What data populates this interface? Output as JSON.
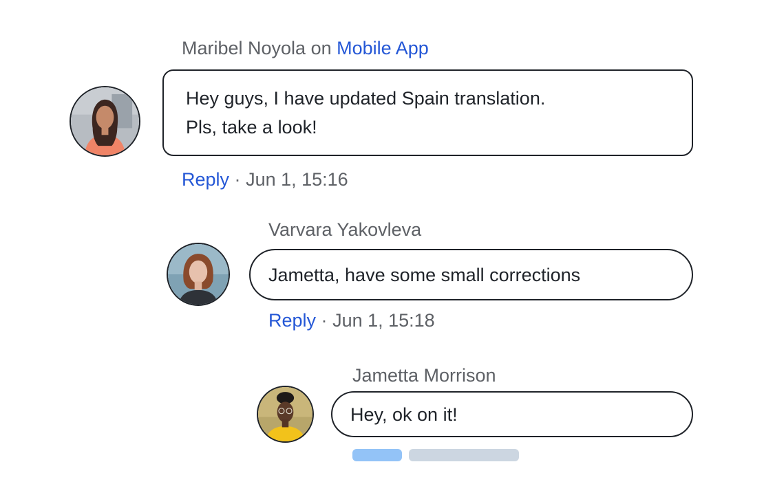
{
  "comments": [
    {
      "author": "Maribel Noyola",
      "connector": "on",
      "channel": "Mobile App",
      "message_lines": [
        "Hey guys, I have updated Spain translation.",
        "Pls, take a look!"
      ],
      "reply_label": "Reply",
      "separator": "·",
      "timestamp": "Jun 1, 15:16",
      "avatar": "maribel-avatar-photo"
    },
    {
      "author": "Varvara Yakovleva",
      "message": "Jametta, have some small corrections",
      "reply_label": "Reply",
      "separator": "·",
      "timestamp": "Jun 1, 15:18",
      "avatar": "varvara-avatar-photo"
    },
    {
      "author": "Jametta Morrison",
      "message": "Hey, ok on it!",
      "avatar": "jametta-avatar-photo"
    }
  ],
  "colors": {
    "link": "#2457d6",
    "text": "#1f2329",
    "muted": "#5e6166",
    "border": "#1e2228",
    "typing_primary": "#93c3f7",
    "typing_secondary": "#ccd6e1"
  }
}
